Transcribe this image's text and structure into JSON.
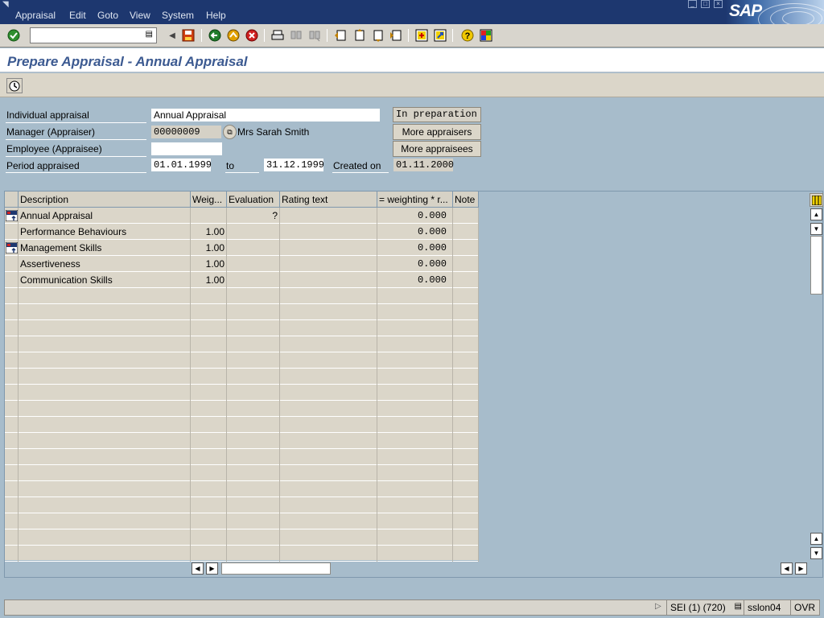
{
  "menu": {
    "items": [
      "Appraisal",
      "Edit",
      "Goto",
      "View",
      "System",
      "Help"
    ],
    "logo_text": "SAP"
  },
  "toolbar": {
    "command_value": "",
    "icons": [
      "enter-icon",
      "command-dropdown-icon",
      "back-arrow-icon",
      "save-icon",
      "back-icon",
      "exit-icon",
      "cancel-icon",
      "print-icon",
      "find-icon",
      "find-next-icon",
      "first-page-icon",
      "previous-page-icon",
      "next-page-icon",
      "last-page-icon",
      "create-session-icon",
      "shortcut-icon",
      "help-icon",
      "layout-menu-icon"
    ]
  },
  "title": "Prepare Appraisal - Annual Appraisal",
  "header": {
    "individual_label": "Individual appraisal",
    "individual_value": "Annual Appraisal",
    "status": "In preparation",
    "manager_label": "Manager (Appraiser)",
    "manager_id": "00000009",
    "manager_name": "Mrs Sarah Smith",
    "more_appraisers": "More appraisers",
    "employee_label": "Employee (Appraisee)",
    "employee_value": "",
    "more_appraisees": "More appraisees",
    "period_label": "Period appraised",
    "period_from": "01.01.1999",
    "to_label": "to",
    "period_to": "31.12.1999",
    "created_label": "Created on",
    "created_value": "01.11.2000"
  },
  "table": {
    "columns": [
      "Description",
      "Weig...",
      "Evaluation",
      "Rating text",
      "= weighting  * r...",
      "Note"
    ],
    "rows": [
      {
        "description": "Annual Appraisal",
        "weight": "",
        "evaluation": "?",
        "rating_text": "",
        "weighting": "0.000",
        "note": "",
        "node": true
      },
      {
        "description": "Performance Behaviours",
        "weight": "1.00",
        "evaluation": "",
        "rating_text": "",
        "weighting": "0.000",
        "note": "",
        "node": false
      },
      {
        "description": "Management Skills",
        "weight": "1.00",
        "evaluation": "",
        "rating_text": "",
        "weighting": "0.000",
        "note": "",
        "node": true
      },
      {
        "description": "Assertiveness",
        "weight": "1.00",
        "evaluation": "",
        "rating_text": "",
        "weighting": "0.000",
        "note": "",
        "node": false
      },
      {
        "description": "Communication Skills",
        "weight": "1.00",
        "evaluation": "",
        "rating_text": "",
        "weighting": "0.000",
        "note": "",
        "node": false
      }
    ],
    "empty_rows": 17
  },
  "status_bar": {
    "system": "SEI (1) (720)",
    "server": "sslon04",
    "mode": "OVR"
  },
  "colors": {
    "menu_bg": "#1d376f",
    "title_text": "#3c5a91",
    "screen_bg": "#a7bccb",
    "grid_bg": "#dbd6c9"
  }
}
